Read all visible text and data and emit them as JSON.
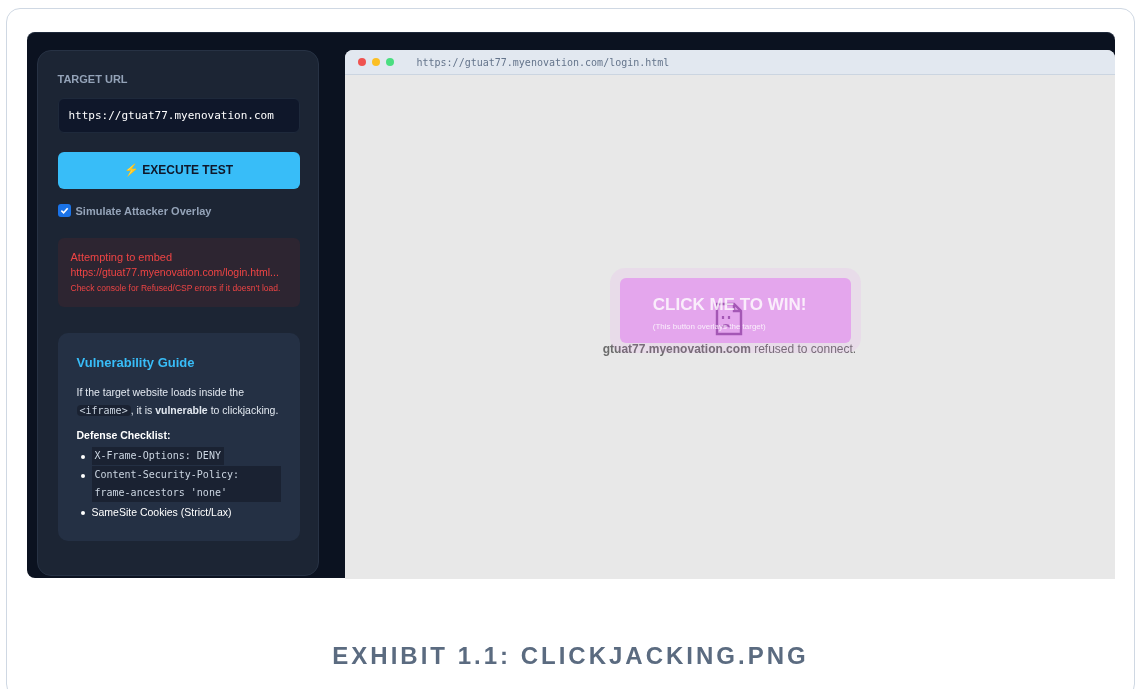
{
  "sidebar": {
    "target_url": {
      "label": "TARGET URL",
      "value": "https://gtuat77.myenovation.com"
    },
    "execute_button": {
      "icon": "⚡",
      "label": "EXECUTE TEST"
    },
    "overlay_option": {
      "label": "Simulate Attacker Overlay",
      "checked": true
    },
    "status": {
      "title": "Attempting to embed",
      "url": "https://gtuat77.myenovation.com/login.html...",
      "note": "Check console for Refused/CSP errors if it doesn't load."
    },
    "guide": {
      "title": "Vulnerability Guide",
      "intro_before": "If the target website loads inside the",
      "intro_code": "<iframe>",
      "intro_after": ", it is **vulnerable** to clickjacking.",
      "checklist_title": "Defense Checklist:",
      "checklist": [
        {
          "kind": "code",
          "text": "X-Frame-Options: DENY"
        },
        {
          "kind": "code",
          "text": "Content-Security-Policy: frame-ancestors 'none'"
        },
        {
          "kind": "text",
          "text": "SameSite Cookies (Strict/Lax)"
        }
      ]
    }
  },
  "browser": {
    "address": "https://gtuat77.myenovation.com/login.html",
    "error": {
      "host": "gtuat77.myenovation.com",
      "message": "refused to connect."
    },
    "overlay": {
      "title": "CLICK ME TO WIN!",
      "subtitle": "(This button overlays the target)"
    }
  },
  "caption": "EXHIBIT 1.1: CLICKJACKING.PNG"
}
